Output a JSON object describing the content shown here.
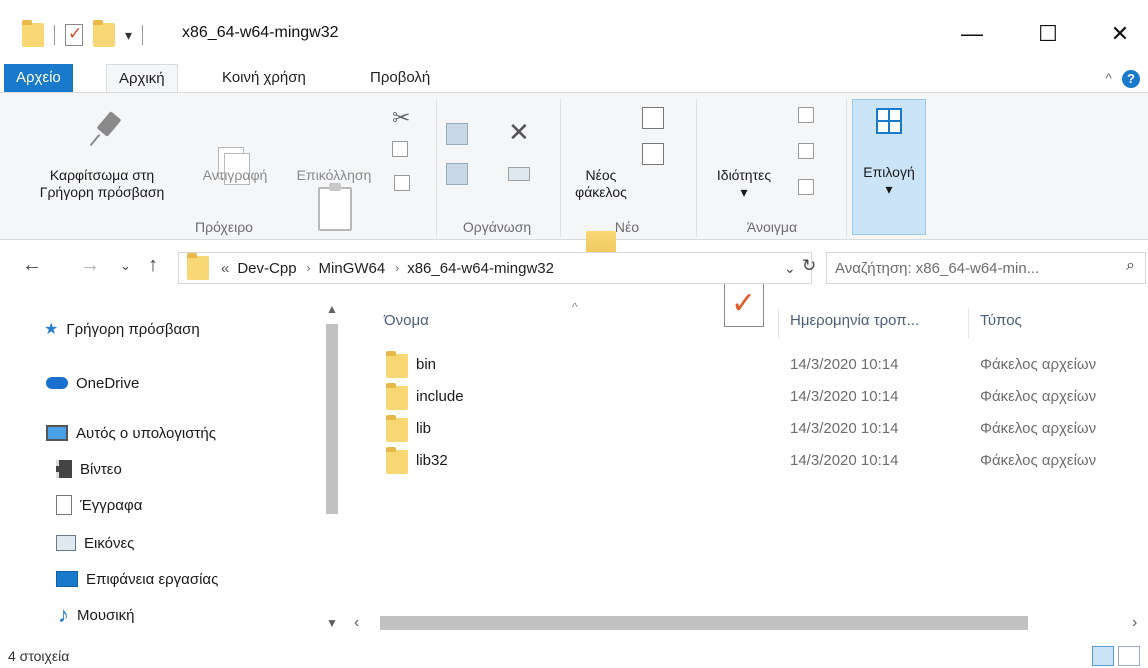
{
  "window": {
    "title": "x86_64-w64-mingw32",
    "quick_access_dropdown": "▾",
    "minimize": "—",
    "maximize": "☐",
    "close": "✕"
  },
  "tabs": [
    {
      "label": "Αρχείο"
    },
    {
      "label": "Αρχική"
    },
    {
      "label": "Κοινή χρήση"
    },
    {
      "label": "Προβολή"
    }
  ],
  "ribbon": {
    "clipboard": {
      "group_label": "Πρόχειρο",
      "pin_label_line1": "Καρφίτσωμα στη",
      "pin_label_line2": "Γρήγορη πρόσβαση",
      "copy_label": "Αντιγραφή",
      "paste_label": "Επικόλληση"
    },
    "organize": {
      "group_label": "Οργάνωση"
    },
    "new": {
      "group_label": "Νέο",
      "new_folder_line1": "Νέος",
      "new_folder_line2": "φάκελος"
    },
    "open": {
      "group_label": "Άνοιγμα",
      "properties_label": "Ιδιότητες"
    },
    "select": {
      "select_label": "Επιλογή"
    }
  },
  "address": {
    "overflow": "«",
    "crumbs": [
      "Dev-Cpp",
      "MinGW64",
      "x86_64-w64-mingw32"
    ],
    "separator": "›",
    "search_placeholder": "Αναζήτηση: x86_64-w64-min..."
  },
  "navpane": {
    "items": [
      {
        "label": "Γρήγορη πρόσβαση",
        "icon": "star-icon"
      },
      {
        "label": "OneDrive",
        "icon": "cloud-icon"
      },
      {
        "label": "Αυτός ο υπολογιστής",
        "icon": "pc-icon"
      },
      {
        "label": "Βίντεο",
        "icon": "video-icon"
      },
      {
        "label": "Έγγραφα",
        "icon": "documents-icon"
      },
      {
        "label": "Εικόνες",
        "icon": "pictures-icon"
      },
      {
        "label": "Επιφάνεια εργασίας",
        "icon": "desktop-icon"
      },
      {
        "label": "Μουσική",
        "icon": "music-icon"
      }
    ]
  },
  "content": {
    "columns": {
      "name": "Όνομα",
      "date": "Ημερομηνία τροπ...",
      "type": "Τύπος"
    },
    "rows": [
      {
        "name": "bin",
        "date": "14/3/2020 10:14",
        "type": "Φάκελος αρχείων"
      },
      {
        "name": "include",
        "date": "14/3/2020 10:14",
        "type": "Φάκελος αρχείων"
      },
      {
        "name": "lib",
        "date": "14/3/2020 10:14",
        "type": "Φάκελος αρχείων"
      },
      {
        "name": "lib32",
        "date": "14/3/2020 10:14",
        "type": "Φάκελος αρχείων"
      }
    ]
  },
  "status": {
    "item_count": "4 στοιχεία"
  },
  "colors": {
    "accent": "#1979ca",
    "folder": "#f8d775"
  }
}
